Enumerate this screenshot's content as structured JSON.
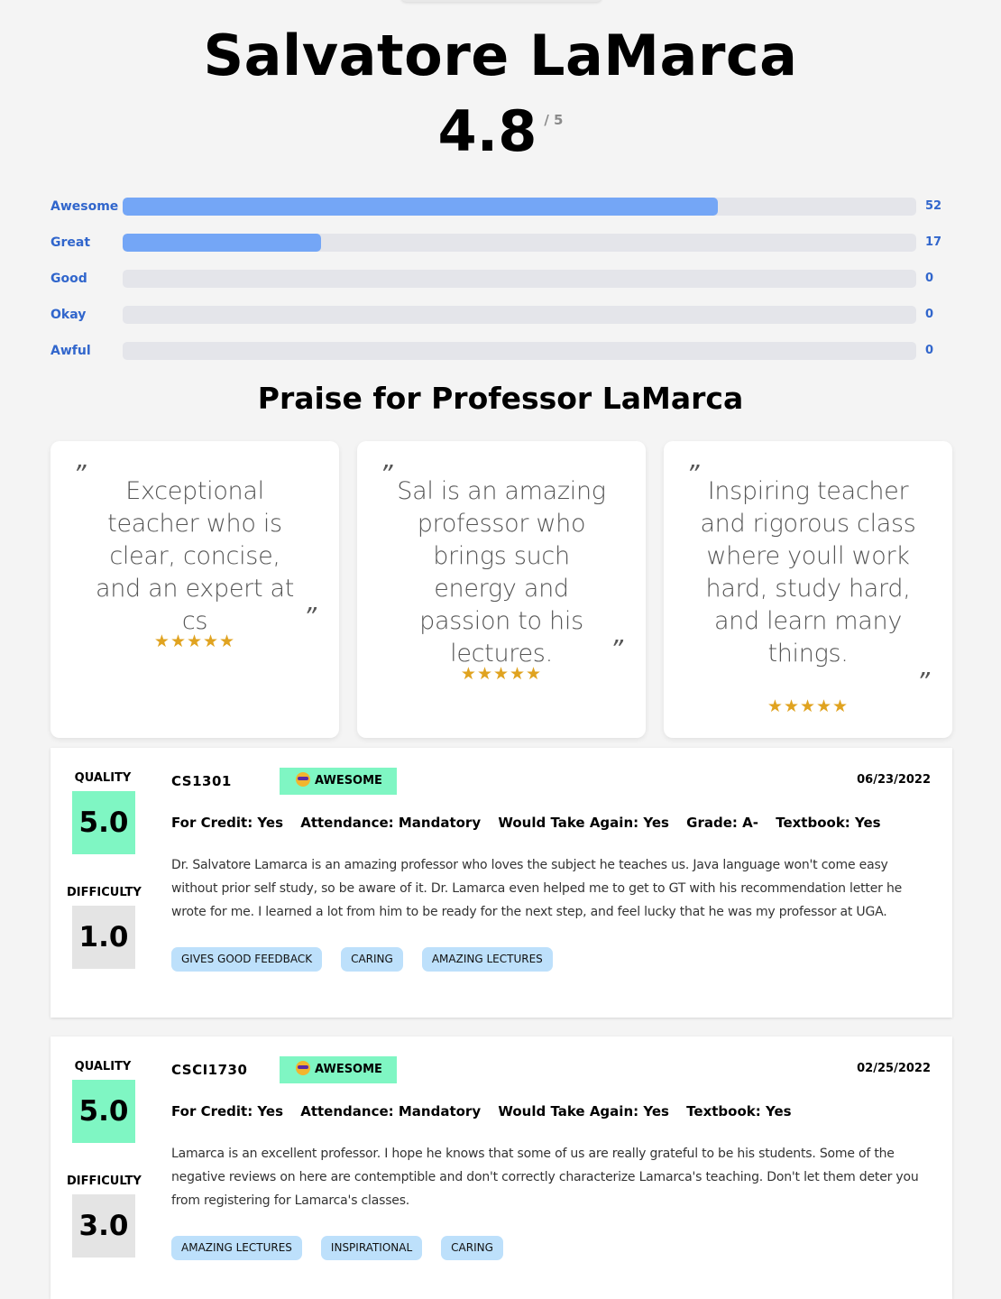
{
  "professor": {
    "name": "Salvatore LaMarca",
    "avg_rating": "4.8",
    "avg_max": "/ 5"
  },
  "distribution": [
    {
      "label": "Awesome",
      "count": "52",
      "fraction": 0.75
    },
    {
      "label": "Great",
      "count": "17",
      "fraction": 0.25
    },
    {
      "label": "Good",
      "count": "0",
      "fraction": 0
    },
    {
      "label": "Okay",
      "count": "0",
      "fraction": 0
    },
    {
      "label": "Awful",
      "count": "0",
      "fraction": 0
    }
  ],
  "praise": {
    "title": "Praise for Professor LaMarca",
    "quotes": [
      {
        "open": "”",
        "text": "Exceptional teacher who is clear, concise, and an expert at cs",
        "close": "”",
        "stars": "★★★★★"
      },
      {
        "open": "”",
        "text": "Sal is an amazing professor who brings such energy and passion to his lectures.",
        "close": "”",
        "stars": "★★★★★"
      },
      {
        "open": "”",
        "text": "Inspiring teacher and rigorous class where youll work hard, study hard, and learn many things.",
        "close": "”",
        "stars": "★★★★★"
      }
    ]
  },
  "reviews": [
    {
      "quality_label": "QUALITY",
      "quality": "5.0",
      "difficulty_label": "DIFFICULTY",
      "difficulty": "1.0",
      "course": "CS1301",
      "badge": "AWESOME",
      "badge_icon": "sunglasses-emoji-icon",
      "date": "06/23/2022",
      "meta": [
        "For Credit: Yes",
        "Attendance: Mandatory",
        "Would Take Again: Yes",
        "Grade: A-",
        "Textbook: Yes"
      ],
      "comment": "Dr. Salvatore Lamarca is an amazing professor who loves the subject he teaches us. Java language won't come easy without prior self study, so be aware of it. Dr. Lamarca even helped me to get to GT with his recommendation letter he wrote for me. I learned a lot from him to be ready for the next step, and feel lucky that he was my professor at UGA.",
      "tags": [
        "GIVES GOOD FEEDBACK",
        "CARING",
        "AMAZING LECTURES"
      ]
    },
    {
      "quality_label": "QUALITY",
      "quality": "5.0",
      "difficulty_label": "DIFFICULTY",
      "difficulty": "3.0",
      "course": "CSCI1730",
      "badge": "AWESOME",
      "badge_icon": "sunglasses-emoji-icon",
      "date": "02/25/2022",
      "meta": [
        "For Credit: Yes",
        "Attendance: Mandatory",
        "Would Take Again: Yes",
        "Textbook: Yes"
      ],
      "comment": "Lamarca is an excellent professor. I hope he knows that some of us are really grateful to be his students. Some of the negative reviews on here are contemptible and don't correctly characterize Lamarca's teaching. Don't let them deter you from registering for Lamarca's classes.",
      "tags": [
        "AMAZING LECTURES",
        "INSPIRATIONAL",
        "CARING"
      ]
    }
  ],
  "colors": {
    "quality_box": "#7ff6c3",
    "difficulty_box": "#e4e4e4",
    "bar_fill": "#74a6f6",
    "bar_track": "#e4e5ea",
    "dist_text": "#3166cc",
    "star": "#e0a320",
    "tag_bg": "#bde0fb"
  }
}
